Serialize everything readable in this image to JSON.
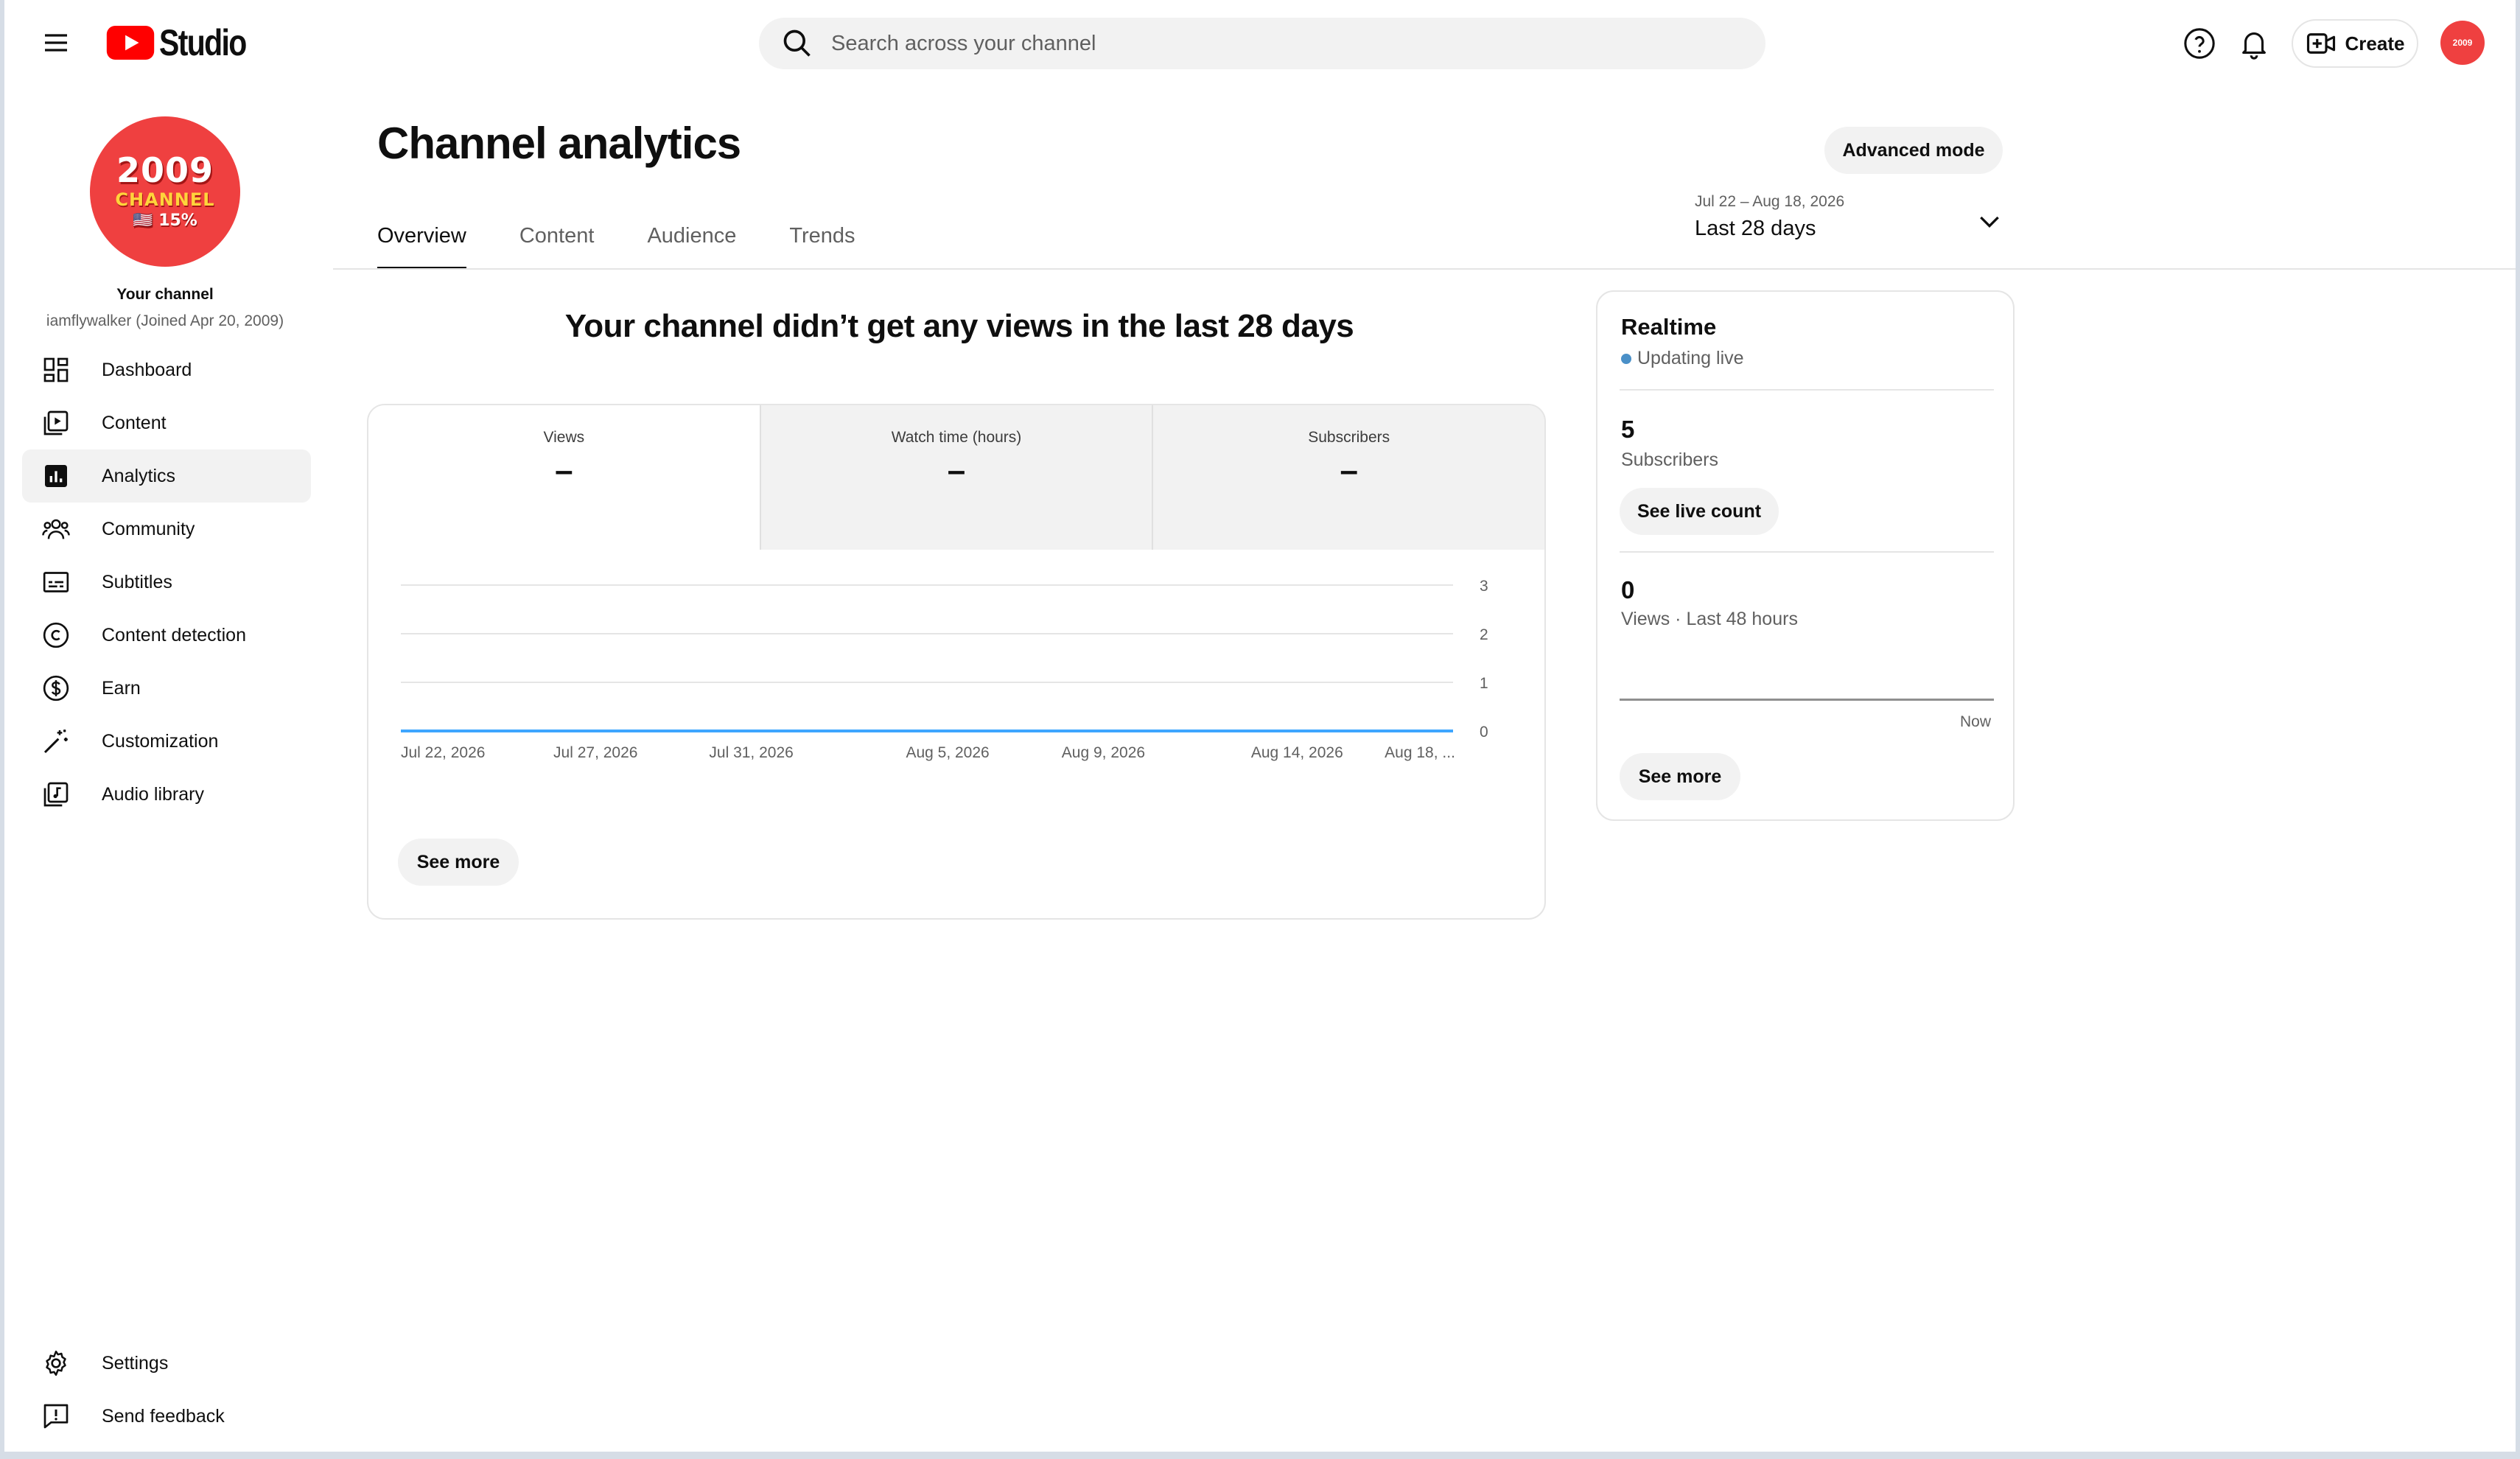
{
  "header": {
    "logo_text": "Studio",
    "search_placeholder": "Search across your channel",
    "create_label": "Create"
  },
  "sidebar": {
    "avatar_lines": [
      "2009",
      "CHANNEL",
      "🇺🇸 15%"
    ],
    "channel_title": "Your channel",
    "channel_sub": "iamflywalker (Joined Apr 20, 2009)",
    "items": [
      {
        "label": "Dashboard",
        "icon": "dashboard-icon"
      },
      {
        "label": "Content",
        "icon": "content-icon"
      },
      {
        "label": "Analytics",
        "icon": "analytics-icon",
        "active": true
      },
      {
        "label": "Community",
        "icon": "community-icon"
      },
      {
        "label": "Subtitles",
        "icon": "subtitles-icon"
      },
      {
        "label": "Content detection",
        "icon": "copyright-icon"
      },
      {
        "label": "Earn",
        "icon": "dollar-icon"
      },
      {
        "label": "Customization",
        "icon": "magic-wand-icon"
      },
      {
        "label": "Audio library",
        "icon": "audio-library-icon"
      }
    ],
    "bottom_items": [
      {
        "label": "Settings",
        "icon": "gear-icon"
      },
      {
        "label": "Send feedback",
        "icon": "feedback-icon"
      }
    ]
  },
  "main": {
    "title": "Channel analytics",
    "advanced_mode_label": "Advanced mode",
    "tabs": [
      "Overview",
      "Content",
      "Audience",
      "Trends"
    ],
    "active_tab": "Overview",
    "date_range": {
      "dates": "Jul 22 – Aug 18, 2026",
      "label": "Last 28 days"
    },
    "headline": "Your channel didn’t get any views in the last 28 days",
    "metrics": [
      {
        "label": "Views",
        "value": "–"
      },
      {
        "label": "Watch time (hours)",
        "value": "–"
      },
      {
        "label": "Subscribers",
        "value": "–"
      }
    ],
    "see_more_label": "See more"
  },
  "chart_data": {
    "type": "line",
    "x": [
      "Jul 22, 2026",
      "Jul 27, 2026",
      "Jul 31, 2026",
      "Aug 5, 2026",
      "Aug 9, 2026",
      "Aug 14, 2026",
      "Aug 18, ..."
    ],
    "series": [
      {
        "values": [
          0,
          0,
          0,
          0,
          0,
          0,
          0
        ]
      }
    ],
    "y_ticks": [
      "3",
      "2",
      "1",
      "0"
    ],
    "ylim": [
      0,
      3
    ],
    "grid": true,
    "line_color": "#3ea6ff"
  },
  "realtime": {
    "title": "Realtime",
    "status": "Updating live",
    "subscribers_value": "5",
    "subscribers_label": "Subscribers",
    "live_count_label": "See live count",
    "views_value": "0",
    "views_label": "Views · Last 48 hours",
    "now_label": "Now",
    "see_more_label": "See more"
  },
  "colors": {
    "accent": "#ff0000",
    "brand_avatar": "#ef4040",
    "live_dot": "#4a90c8"
  }
}
